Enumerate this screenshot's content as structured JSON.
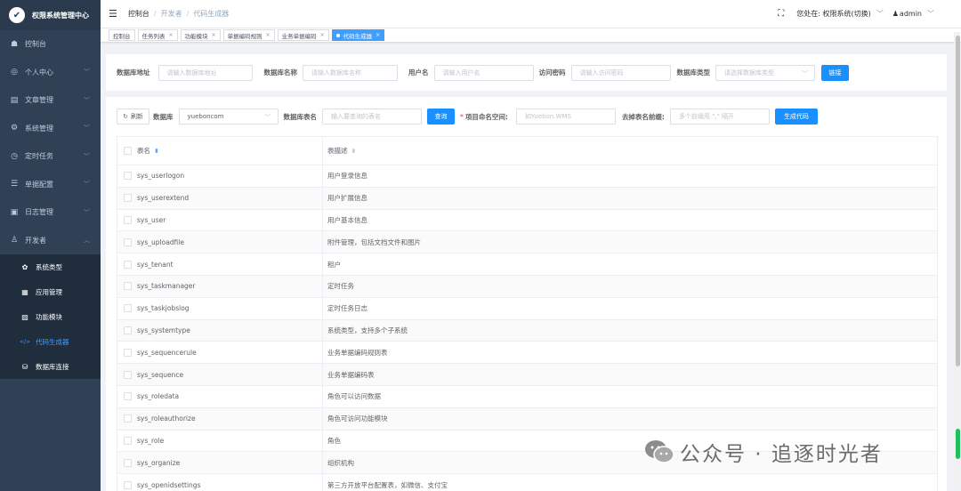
{
  "sidebar": {
    "logo_text": "权限系统管理中心",
    "menu": [
      {
        "label": "控制台",
        "icon": "dashboard-icon",
        "glyph": "☗",
        "has_children": false
      },
      {
        "label": "个人中心",
        "icon": "user-circle-icon",
        "glyph": "◎",
        "has_children": true
      },
      {
        "label": "文章管理",
        "icon": "article-icon",
        "glyph": "▤",
        "has_children": true
      },
      {
        "label": "系统管理",
        "icon": "gear-icon",
        "glyph": "⚙",
        "has_children": true
      },
      {
        "label": "定时任务",
        "icon": "clock-icon",
        "glyph": "◷",
        "has_children": true
      },
      {
        "label": "单据配置",
        "icon": "config-icon",
        "glyph": "☰",
        "has_children": true
      },
      {
        "label": "日志管理",
        "icon": "log-icon",
        "glyph": "▣",
        "has_children": true
      },
      {
        "label": "开发者",
        "icon": "developer-icon",
        "glyph": "♙",
        "has_children": true,
        "expanded": true
      }
    ],
    "submenu": [
      {
        "label": "系统类型",
        "icon": "gear-icon",
        "glyph": "✿",
        "active": false
      },
      {
        "label": "应用管理",
        "icon": "apps-icon",
        "glyph": "▦",
        "active": false
      },
      {
        "label": "功能模块",
        "icon": "module-icon",
        "glyph": "▨",
        "active": false
      },
      {
        "label": "代码生成器",
        "icon": "code-icon",
        "glyph": "</>",
        "active": true
      },
      {
        "label": "数据库连接",
        "icon": "database-icon",
        "glyph": "⛁",
        "active": false
      }
    ]
  },
  "header": {
    "breadcrumb": [
      {
        "label": "控制台",
        "muted": false
      },
      {
        "label": "开发者",
        "muted": true
      },
      {
        "label": "代码生成器",
        "muted": true
      }
    ],
    "location_text": "您处在: 权限系统(切换)",
    "user": "admin"
  },
  "tags": [
    {
      "label": "控制台",
      "closable": false,
      "active": false
    },
    {
      "label": "任务列表",
      "closable": true,
      "active": false
    },
    {
      "label": "功能模块",
      "closable": true,
      "active": false
    },
    {
      "label": "单据编码规则",
      "closable": true,
      "active": false
    },
    {
      "label": "业务单据编码",
      "closable": true,
      "active": false
    },
    {
      "label": "代码生成器",
      "closable": true,
      "active": true
    }
  ],
  "connection_form": {
    "db_address_label": "数据库地址",
    "db_address_placeholder": "请输入数据库地址",
    "db_name_label": "数据库名称",
    "db_name_placeholder": "请输入数据库名称",
    "username_label": "用户名",
    "username_placeholder": "请输入用户名",
    "password_label": "访问密码",
    "password_placeholder": "请输入访问密码",
    "db_type_label": "数据库类型",
    "db_type_placeholder": "请选择数据库类型",
    "connect_button": "链接"
  },
  "toolbar": {
    "refresh_button": "刷新",
    "database_label": "数据库",
    "database_value": "yueboncom",
    "table_name_label": "数据库表名",
    "table_name_placeholder": "输入要查询的表名",
    "search_button": "查询",
    "namespace_label": "项目命名空间:",
    "namespace_placeholder": "如Yuebon.WMS",
    "prefix_label": "去掉表名前缀:",
    "prefix_placeholder": "多个前缀用 \",\" 隔开",
    "generate_button": "生成代码"
  },
  "table": {
    "headers": {
      "name": "表名",
      "desc": "表描述"
    },
    "rows": [
      {
        "name": "sys_userlogon",
        "desc": "用户登录信息"
      },
      {
        "name": "sys_userextend",
        "desc": "用户扩展信息"
      },
      {
        "name": "sys_user",
        "desc": "用户基本信息"
      },
      {
        "name": "sys_uploadfile",
        "desc": "附件管理，包括文档文件和图片"
      },
      {
        "name": "sys_tenant",
        "desc": "租户"
      },
      {
        "name": "sys_taskmanager",
        "desc": "定时任务"
      },
      {
        "name": "sys_taskjobslog",
        "desc": "定时任务日志"
      },
      {
        "name": "sys_systemtype",
        "desc": "系统类型，支持多个子系统"
      },
      {
        "name": "sys_sequencerule",
        "desc": "业务单据编码规则表"
      },
      {
        "name": "sys_sequence",
        "desc": "业务单据编码表"
      },
      {
        "name": "sys_roledata",
        "desc": "角色可以访问数据"
      },
      {
        "name": "sys_roleauthorize",
        "desc": "角色可访问功能模块"
      },
      {
        "name": "sys_role",
        "desc": "角色"
      },
      {
        "name": "sys_organize",
        "desc": "组织机构"
      },
      {
        "name": "sys_openidsettings",
        "desc": "第三方开放平台配置表，如微信、支付宝"
      }
    ]
  },
  "watermark": {
    "text": "公众号 · 追逐时光者"
  }
}
